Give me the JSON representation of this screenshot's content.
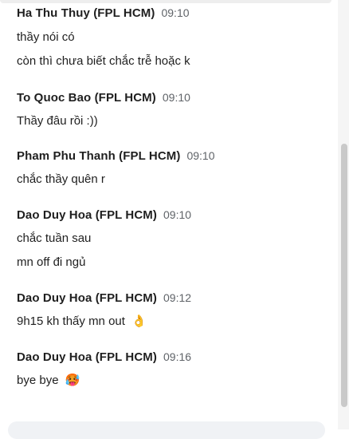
{
  "messages": [
    {
      "sender": "Ha Thu Thuy (FPL HCM)",
      "time": "09:10",
      "lines": [
        "thầy nói có",
        "còn thì chưa biết chắc trễ hoặc k"
      ]
    },
    {
      "sender": "To Quoc Bao (FPL HCM)",
      "time": "09:10",
      "lines": [
        "Thầy đâu rồi :))"
      ]
    },
    {
      "sender": "Pham Phu Thanh (FPL HCM)",
      "time": "09:10",
      "lines": [
        "chắc thầy quên r"
      ]
    },
    {
      "sender": "Dao Duy Hoa (FPL HCM)",
      "time": "09:10",
      "lines": [
        "chắc tuần sau",
        "mn off đi ngủ"
      ]
    },
    {
      "sender": "Dao Duy Hoa (FPL HCM)",
      "time": "09:12",
      "lines": [
        "9h15 kh thấy mn out"
      ],
      "emoji": "👌"
    },
    {
      "sender": "Dao Duy Hoa (FPL HCM)",
      "time": "09:16",
      "lines": [
        "bye bye"
      ],
      "emoji": "🥵"
    }
  ],
  "icons": {
    "ok_hand": "ok-hand-emoji",
    "hot_face": "hot-face-emoji"
  }
}
